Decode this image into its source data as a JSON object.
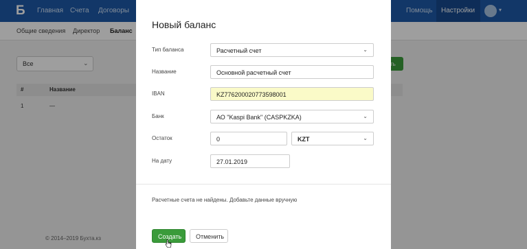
{
  "topnav": {
    "logo": "Б",
    "items": [
      "Главная",
      "Счета",
      "Договоры"
    ],
    "help": "Помощь",
    "settings": "Настройки"
  },
  "subnav": {
    "items": [
      "Общие сведения",
      "Директор",
      "Баланс"
    ]
  },
  "page": {
    "filter_value": "Все",
    "add_button_partial": "ть",
    "table_headers": [
      "#",
      "Название"
    ],
    "rows": [
      [
        "1",
        "—"
      ]
    ],
    "footer": "© 2014–2019 Бухта.кз"
  },
  "modal": {
    "title": "Новый баланс",
    "fields": {
      "balance_type": {
        "label": "Тип баланса",
        "value": "Расчетный счет"
      },
      "name": {
        "label": "Название",
        "value": "Основной расчетный счет"
      },
      "iban": {
        "label": "IBAN",
        "value": "KZ776200020773598001"
      },
      "bank": {
        "label": "Банк",
        "value": "АО \"Kaspi Bank\" (CASPKZKA)"
      },
      "balance": {
        "label": "Остаток",
        "value": "0",
        "currency": "KZT"
      },
      "date": {
        "label": "На дату",
        "value": "27.01.2019"
      }
    },
    "note": "Расчетные счета не найдены. Добавьте данные вручную",
    "create_label": "Создать",
    "cancel_label": "Отменить"
  },
  "colors": {
    "primary": "#1e5aa8",
    "success": "#3a9b3a",
    "highlight": "#fafac8"
  }
}
